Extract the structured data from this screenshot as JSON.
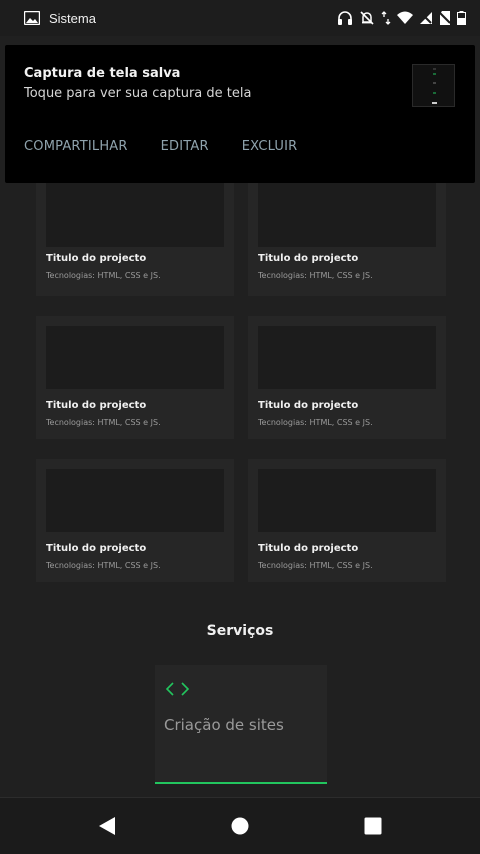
{
  "statusbar": {
    "app_name": "Sistema",
    "icons": [
      "image-icon",
      "headphones-icon",
      "bell-off-icon",
      "data-arrows-icon",
      "wifi-icon",
      "no-signal-icon",
      "no-sim-icon",
      "battery-icon"
    ]
  },
  "notification": {
    "title": "Captura de tela salva",
    "subtitle": "Toque para ver sua captura de tela",
    "actions": [
      "COMPARTILHAR",
      "EDITAR",
      "EXCLUIR"
    ]
  },
  "projects": [
    {
      "title": "Titulo do projecto",
      "tech": "Tecnologias: HTML, CSS e JS."
    },
    {
      "title": "Titulo do projecto",
      "tech": "Tecnologias: HTML, CSS e JS."
    },
    {
      "title": "Titulo do projecto",
      "tech": "Tecnologias: HTML, CSS e JS."
    },
    {
      "title": "Titulo do projecto",
      "tech": "Tecnologias: HTML, CSS e JS."
    },
    {
      "title": "Titulo do projecto",
      "tech": "Tecnologias: HTML, CSS e JS."
    },
    {
      "title": "Titulo do projecto",
      "tech": "Tecnologias: HTML, CSS e JS."
    }
  ],
  "services": {
    "title": "Serviços",
    "items": [
      {
        "name": "Criação de sites",
        "icon": "code-icon"
      }
    ]
  },
  "navbar": {
    "buttons": [
      "back-icon",
      "home-icon",
      "recents-icon"
    ]
  },
  "colors": {
    "accent": "#22c55e",
    "background": "#202020",
    "card": "#262626",
    "notification": "#000000"
  }
}
